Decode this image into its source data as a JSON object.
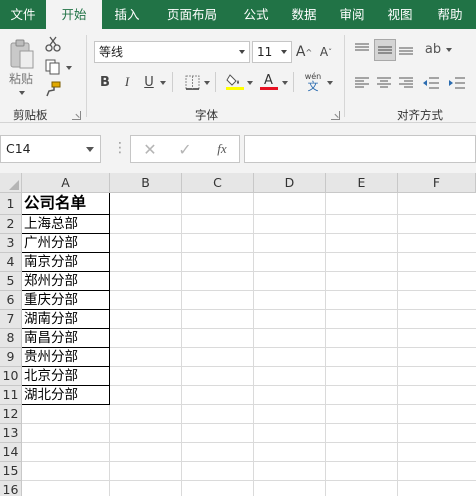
{
  "tabs": [
    {
      "label": "文件",
      "active": false
    },
    {
      "label": "开始",
      "active": true
    },
    {
      "label": "插入",
      "active": false
    },
    {
      "label": "页面布局",
      "active": false
    },
    {
      "label": "公式",
      "active": false
    },
    {
      "label": "数据",
      "active": false
    },
    {
      "label": "审阅",
      "active": false
    },
    {
      "label": "视图",
      "active": false
    },
    {
      "label": "帮助",
      "active": false
    }
  ],
  "ribbon": {
    "clipboard": {
      "paste_label": "粘贴",
      "group_label": "剪贴板"
    },
    "font": {
      "font_name": "等线",
      "font_size": "11",
      "group_label": "字体",
      "phonetic_label": "wén"
    },
    "alignment": {
      "group_label": "对齐方式"
    }
  },
  "formula_bar": {
    "name_box": "C14",
    "formula": ""
  },
  "grid": {
    "columns": [
      "A",
      "B",
      "C",
      "D",
      "E",
      "F"
    ],
    "rows": [
      "1",
      "2",
      "3",
      "4",
      "5",
      "6",
      "7",
      "8",
      "9",
      "10",
      "11",
      "12",
      "13",
      "14",
      "15",
      "16"
    ],
    "column_a": [
      "公司名单",
      "上海总部",
      "广州分部",
      "南京分部",
      "郑州分部",
      "重庆分部",
      "湖南分部",
      "南昌分部",
      "贵州分部",
      "北京分部",
      "湖北分部"
    ]
  },
  "colors": {
    "accent": "#217346",
    "font_color_bar": "#e81123",
    "fill_color_bar": "#ffff00"
  }
}
